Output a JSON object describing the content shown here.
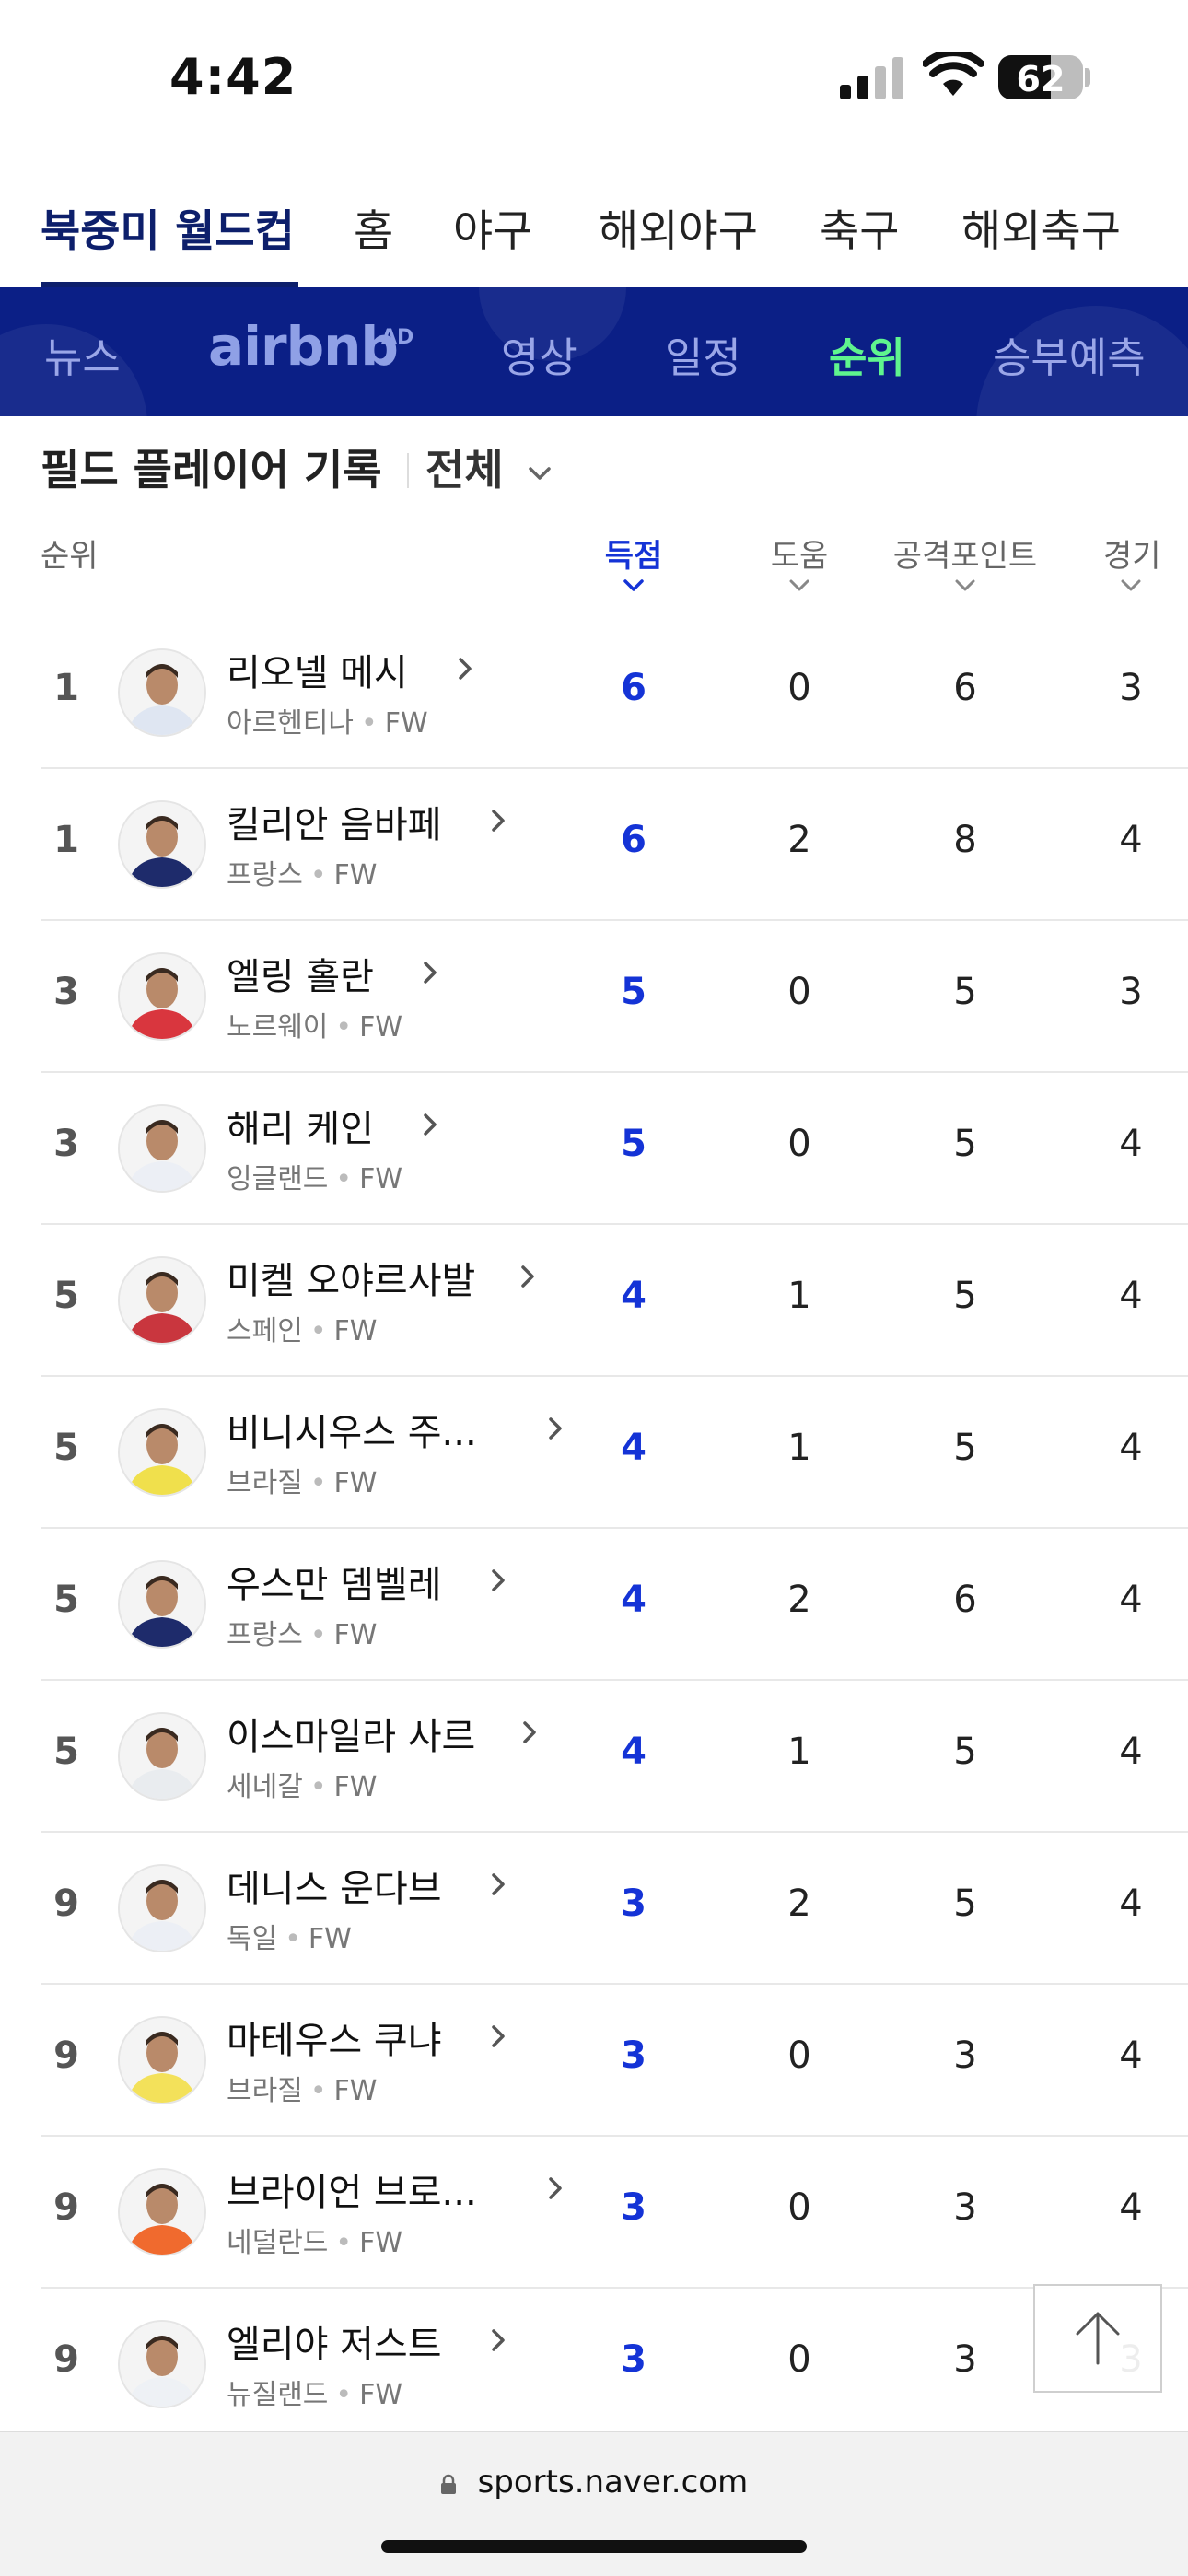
{
  "status_bar": {
    "time": "4:42",
    "battery": "62",
    "battery_level": 0.62
  },
  "main_nav": {
    "items": [
      "북중미 월드컵",
      "홈",
      "야구",
      "해외야구",
      "축구",
      "해외축구"
    ],
    "active": "북중미 월드컵"
  },
  "sub_nav": {
    "items": [
      "뉴스",
      "영상",
      "일정",
      "순위",
      "승부예측"
    ],
    "ad_logo": "airbnb",
    "ad_mark": "AD",
    "active": "순위"
  },
  "section": {
    "title": "필드 플레이어 기록",
    "filter": "전체"
  },
  "table": {
    "columns": {
      "rank": "순위",
      "goals": "득점",
      "assists": "도움",
      "points": "공격포인트",
      "games": "경기"
    },
    "rows": [
      {
        "rank": "1",
        "name": "리오넬 메시",
        "country": "아르헨티나",
        "pos": "FW",
        "goals": "6",
        "assists": "0",
        "points": "6",
        "games": "3"
      },
      {
        "rank": "1",
        "name": "킬리안 음바페",
        "country": "프랑스",
        "pos": "FW",
        "goals": "6",
        "assists": "2",
        "points": "8",
        "games": "4"
      },
      {
        "rank": "3",
        "name": "엘링 홀란",
        "country": "노르웨이",
        "pos": "FW",
        "goals": "5",
        "assists": "0",
        "points": "5",
        "games": "3"
      },
      {
        "rank": "3",
        "name": "해리 케인",
        "country": "잉글랜드",
        "pos": "FW",
        "goals": "5",
        "assists": "0",
        "points": "5",
        "games": "4"
      },
      {
        "rank": "5",
        "name": "미켈 오야르사발",
        "country": "스페인",
        "pos": "FW",
        "goals": "4",
        "assists": "1",
        "points": "5",
        "games": "4"
      },
      {
        "rank": "5",
        "name": "비니시우스 주...",
        "country": "브라질",
        "pos": "FW",
        "goals": "4",
        "assists": "1",
        "points": "5",
        "games": "4"
      },
      {
        "rank": "5",
        "name": "우스만 뎀벨레",
        "country": "프랑스",
        "pos": "FW",
        "goals": "4",
        "assists": "2",
        "points": "6",
        "games": "4"
      },
      {
        "rank": "5",
        "name": "이스마일라 사르",
        "country": "세네갈",
        "pos": "FW",
        "goals": "4",
        "assists": "1",
        "points": "5",
        "games": "4"
      },
      {
        "rank": "9",
        "name": "데니스 운다브",
        "country": "독일",
        "pos": "FW",
        "goals": "3",
        "assists": "2",
        "points": "5",
        "games": "4"
      },
      {
        "rank": "9",
        "name": "마테우스 쿠냐",
        "country": "브라질",
        "pos": "FW",
        "goals": "3",
        "assists": "0",
        "points": "3",
        "games": "4"
      },
      {
        "rank": "9",
        "name": "브라이언 브로...",
        "country": "네덜란드",
        "pos": "FW",
        "goals": "3",
        "assists": "0",
        "points": "3",
        "games": "4"
      },
      {
        "rank": "9",
        "name": "엘리야 저스트",
        "country": "뉴질랜드",
        "pos": "FW",
        "goals": "3",
        "assists": "0",
        "points": "3",
        "games": "3"
      }
    ]
  },
  "url_bar": {
    "domain": "sports.naver.com"
  },
  "colors": {
    "brand_navy": "#0b1f86",
    "active_green": "#5ff58e",
    "goals_blue": "#1433d6"
  },
  "icons": [
    "signal-icon",
    "wifi-icon",
    "battery-icon",
    "chevron-down-icon",
    "chevron-right-icon",
    "arrow-up-icon",
    "lock-icon"
  ]
}
